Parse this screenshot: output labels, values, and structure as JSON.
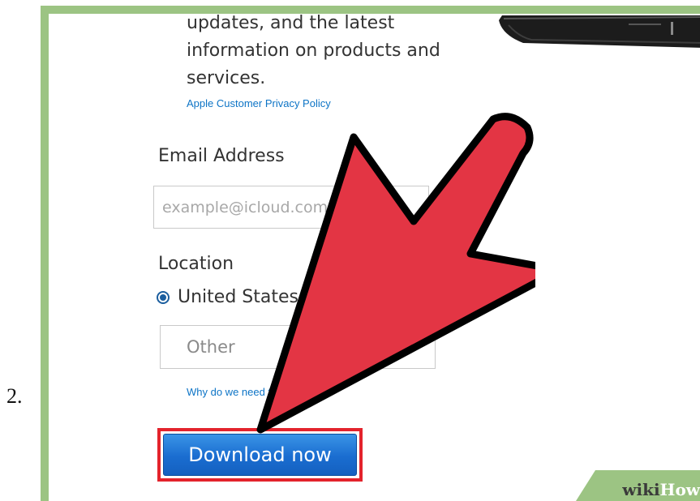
{
  "step": {
    "number": "2."
  },
  "form": {
    "intro_lines": [
      "updates, and the latest",
      "information on products and",
      "services."
    ],
    "privacy_link": "Apple Customer Privacy Policy",
    "email_label": "Email Address",
    "email_placeholder": "example@icloud.com",
    "location_label": "Location",
    "location_selected": "United States",
    "other_placeholder": "Other",
    "why_link": "Why do we need this?",
    "download_label": "Download now"
  },
  "overlay": {
    "arrow_icon": "red-arrow-pointer",
    "highlight_color": "#e3232c"
  },
  "watermark": {
    "wiki": "wiki",
    "how": "How"
  },
  "colors": {
    "frame_green": "#9cc483",
    "link_blue": "#0d74c6",
    "button_blue": "#1a6dd0",
    "arrow_red": "#e33544"
  }
}
